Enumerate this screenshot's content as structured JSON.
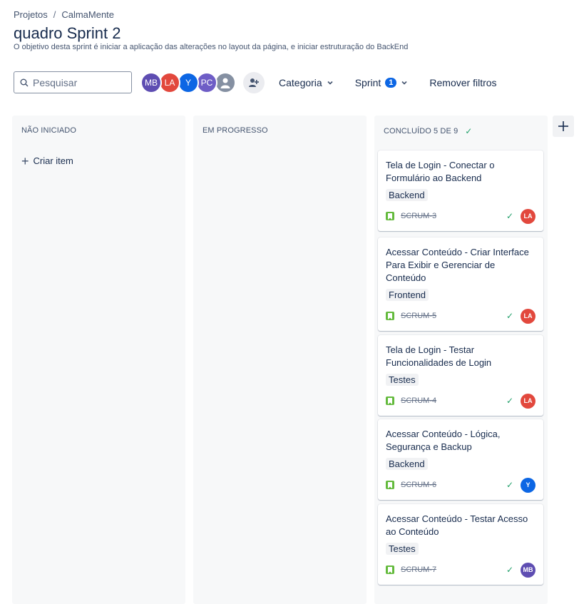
{
  "breadcrumb": {
    "root": "Projetos",
    "separator": "/",
    "project": "CalmaMente"
  },
  "page": {
    "title": "quadro Sprint 2",
    "goal": "O objetivo desta sprint é iniciar a aplicação das alterações no layout da página, e iniciar estruturação do BackEnd"
  },
  "toolbar": {
    "search_placeholder": "Pesquisar",
    "avatars": [
      {
        "initials": "MB",
        "color": "#5e4db2"
      },
      {
        "initials": "LA",
        "color": "#e2483d"
      },
      {
        "initials": "Y",
        "color": "#0c66e4"
      },
      {
        "initials": "PC",
        "color": "#6e5dc6"
      },
      {
        "initials": "",
        "color": "#8590a2",
        "icon": "user-icon"
      }
    ],
    "add_people_icon": "add-person-icon",
    "category_label": "Categoria",
    "sprint_label": "Sprint",
    "sprint_count": "1",
    "remove_filters_label": "Remover filtros"
  },
  "columns": [
    {
      "title": "NÃO INICIADO",
      "create_label": "Criar item"
    },
    {
      "title": "EM PROGRESSO"
    },
    {
      "title": "CONCLUÍDO 5 DE 9",
      "done_icon": "check-icon"
    }
  ],
  "cards": [
    {
      "title": "Tela de Login - Conectar o Formulário ao Backend",
      "label": "Backend",
      "key": "SCRUM-3",
      "assignee": "LA",
      "assignee_color": "#e2483d"
    },
    {
      "title": "Acessar Conteúdo - Criar Interface Para Exibir e Gerenciar de Conteúdo",
      "label": "Frontend",
      "key": "SCRUM-5",
      "assignee": "LA",
      "assignee_color": "#e2483d"
    },
    {
      "title": "Tela de Login - Testar Funcionalidades de Login",
      "label": "Testes",
      "key": "SCRUM-4",
      "assignee": "LA",
      "assignee_color": "#e2483d"
    },
    {
      "title": "Acessar Conteúdo - Lógica, Segurança e Backup",
      "label": "Backend",
      "key": "SCRUM-6",
      "assignee": "Y",
      "assignee_color": "#0c66e4"
    },
    {
      "title": "Acessar Conteúdo - Testar Acesso ao Conteúdo",
      "label": "Testes",
      "key": "SCRUM-7",
      "assignee": "MB",
      "assignee_color": "#5e4db2"
    }
  ],
  "colors": {
    "story": "#63ba3c",
    "done": "#22a06b",
    "accent": "#0c66e4"
  }
}
